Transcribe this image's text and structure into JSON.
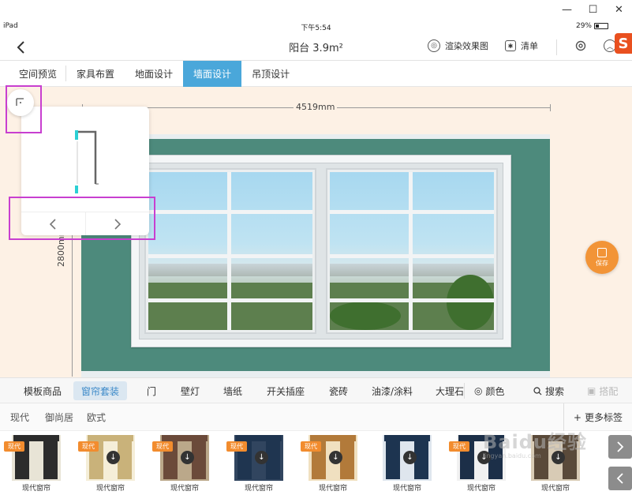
{
  "window": {
    "minimize": "—",
    "maximize": "☐",
    "close": "✕"
  },
  "status": {
    "device": "iPad",
    "time": "下午5:54",
    "battery": "29%"
  },
  "nav": {
    "title": "阳台 3.9m²",
    "render_label": "渲染效果图",
    "list_label": "清单"
  },
  "tabs": [
    "空间预览",
    "家具布置",
    "地面设计",
    "墙面设计",
    "吊顶设计"
  ],
  "active_tab": "墙面设计",
  "canvas": {
    "width_label": "4519mm",
    "height_label": "2800mm"
  },
  "save": {
    "label": "保存"
  },
  "categories": [
    "模板商品",
    "窗帘套装",
    "门",
    "壁灯",
    "墙纸",
    "开关插座",
    "瓷砖",
    "油漆/涂料",
    "大理石"
  ],
  "active_category": "窗帘套装",
  "tools": {
    "color": "颜色",
    "search": "搜索",
    "match": "搭配"
  },
  "styles": [
    "现代",
    "御尚居",
    "欧式"
  ],
  "more_tags": "更多标签",
  "products": [
    {
      "badge": "现代",
      "label": "现代窗帘",
      "color": "#2c2c2c",
      "accent": "#e8e4d6",
      "download": false
    },
    {
      "badge": "现代",
      "label": "现代窗帘",
      "color": "#c9b27a",
      "accent": "#f5eed8",
      "download": true
    },
    {
      "badge": "现代",
      "label": "现代窗帘",
      "color": "#6b4a3a",
      "accent": "#bba88a",
      "download": true
    },
    {
      "badge": "现代",
      "label": "现代窗帘",
      "color": "#1f3550",
      "accent": "#31455f",
      "download": true
    },
    {
      "badge": "现代",
      "label": "现代窗帘",
      "color": "#b27a3a",
      "accent": "#f0e0c0",
      "download": true
    },
    {
      "badge": "",
      "label": "现代窗帘",
      "color": "#1d3450",
      "accent": "#dfe6ee",
      "download": true
    },
    {
      "badge": "现代",
      "label": "现代窗帘",
      "color": "#1c2f48",
      "accent": "#f1f1f1",
      "download": true
    },
    {
      "badge": "",
      "label": "现代窗帘",
      "color": "#5a4a3a",
      "accent": "#d8cbb5",
      "download": true
    }
  ],
  "watermark": {
    "text": "Baidu经验",
    "sub": "jingyan.baidu.com"
  }
}
